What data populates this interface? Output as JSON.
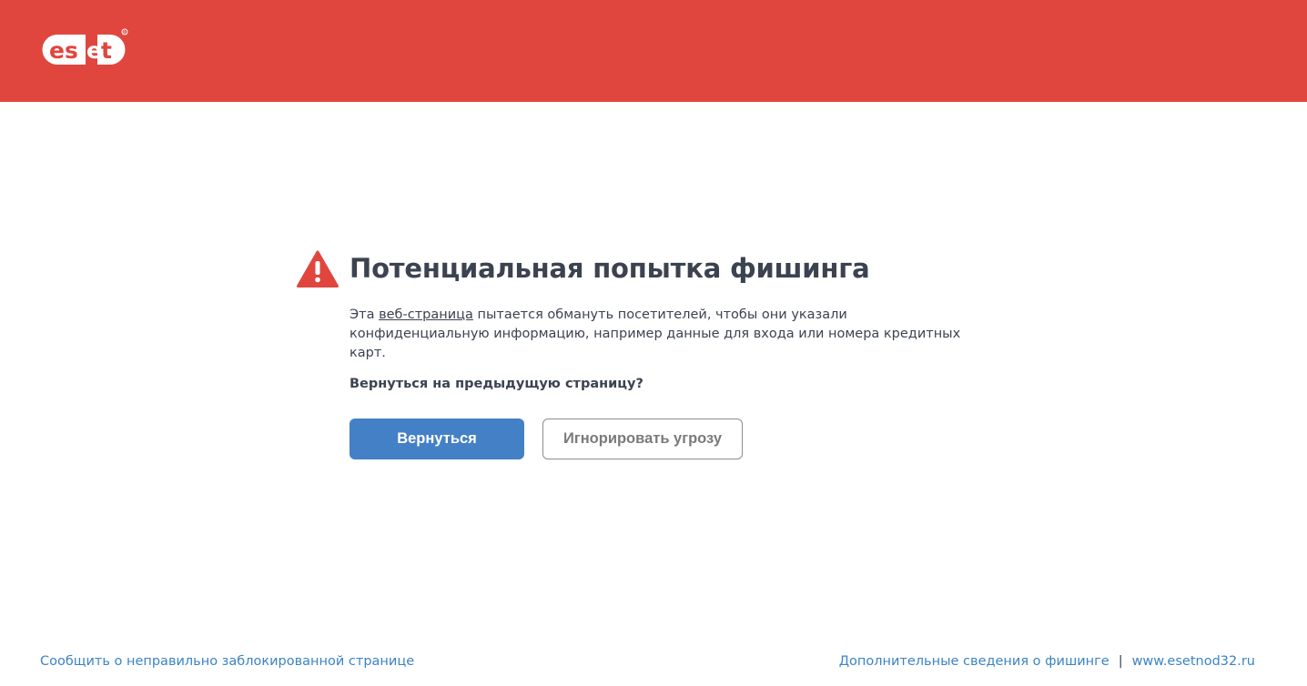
{
  "header": {
    "logo_text": "eset",
    "brand_color": "#e0463e"
  },
  "warning": {
    "icon": "warning-triangle-icon",
    "title": "Потенциальная попытка фишинга",
    "desc_before": "Эта ",
    "desc_link": "веб-страница",
    "desc_after": " пытается обмануть посетителей, чтобы они указали конфиденциальную информацию, например данные для входа или номера кредитных карт.",
    "question": "Вернуться на предыдущую страницу?"
  },
  "buttons": {
    "back_label": "Вернуться",
    "ignore_label": "Игнорировать угрозу",
    "back_color": "#4480c6"
  },
  "footer": {
    "report_link": "Сообщить о неправильно заблокированной странице",
    "more_info_link": "Дополнительные сведения о фишинге",
    "separator": "|",
    "site_link": "www.esetnod32.ru",
    "link_color": "#3c84c5"
  }
}
